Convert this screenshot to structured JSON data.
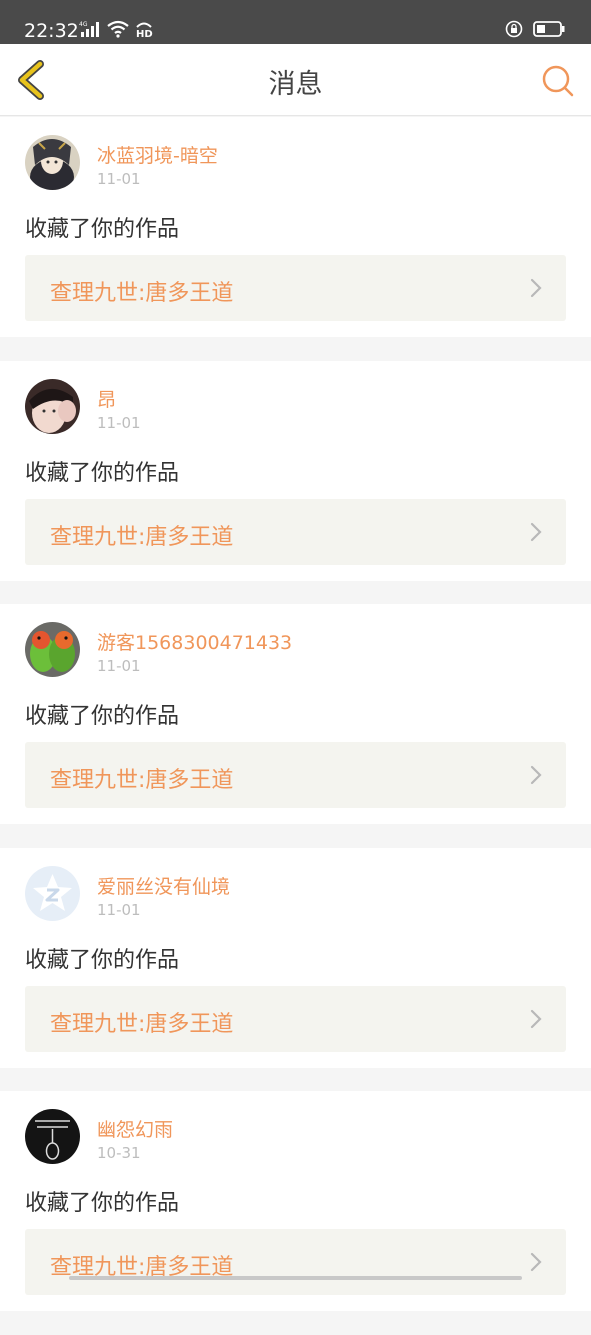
{
  "status": {
    "time": "22:32",
    "network": "4G",
    "hd": "HD"
  },
  "header": {
    "title": "消息"
  },
  "messages": [
    {
      "user": "冰蓝羽境-暗空",
      "date": "11-01",
      "action": "收藏了你的作品",
      "work": "查理九世:唐多王道",
      "avatar": "anime-avatar"
    },
    {
      "user": "昂",
      "date": "11-01",
      "action": "收藏了你的作品",
      "work": "查理九世:唐多王道",
      "avatar": "photo-avatar"
    },
    {
      "user": "游客1568300471433",
      "date": "11-01",
      "action": "收藏了你的作品",
      "work": "查理九世:唐多王道",
      "avatar": "parrot-avatar"
    },
    {
      "user": "爱丽丝没有仙境",
      "date": "11-01",
      "action": "收藏了你的作品",
      "work": "查理九世:唐多王道",
      "avatar": "default-avatar"
    },
    {
      "user": "幽怨幻雨",
      "date": "10-31",
      "action": "收藏了你的作品",
      "work": "查理九世:唐多王道",
      "avatar": "dark-avatar"
    }
  ],
  "colors": {
    "accent": "#f0965a",
    "back": "#e8c31c",
    "card_bg": "#f4f4ef"
  }
}
